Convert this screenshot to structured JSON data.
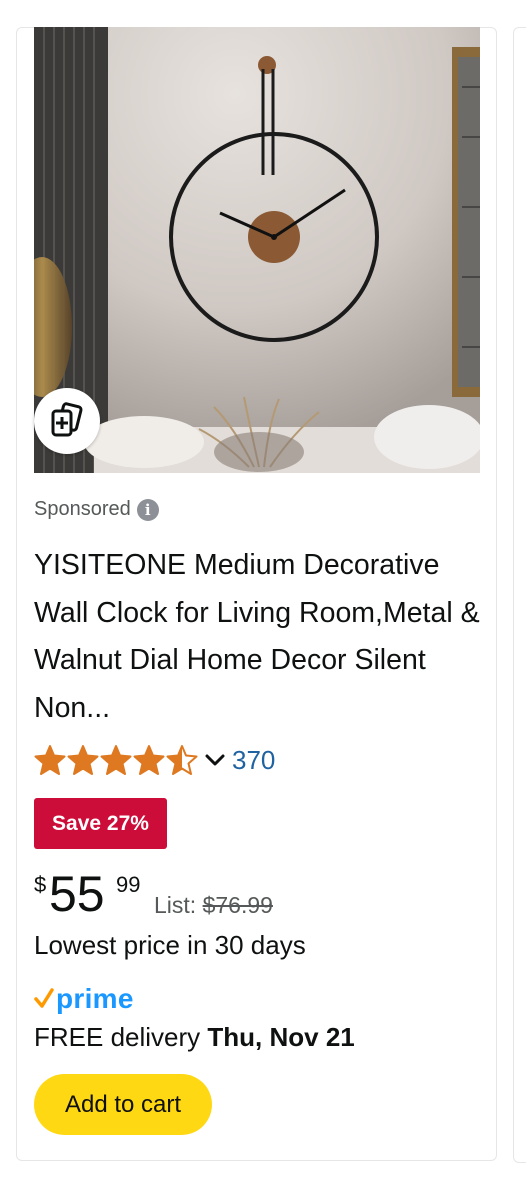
{
  "product": {
    "sponsored_label": "Sponsored",
    "info_glyph": "i",
    "title": "YISITEONE Medium Decorative Wall Clock for Living Room,Metal & Walnut Dial Home Decor Silent Non...",
    "rating": {
      "stars": 4.5,
      "max_stars": 5,
      "review_count": "370"
    },
    "save_badge": "Save 27%",
    "price": {
      "currency": "$",
      "whole": "55",
      "fraction": "99",
      "list_label": "List:",
      "list_value": "$76.99"
    },
    "lowest_price_note": "Lowest price in 30 days",
    "prime_label": "prime",
    "delivery": {
      "prefix": "FREE delivery",
      "date": "Thu, Nov 21"
    },
    "add_to_cart_label": "Add to cart",
    "image_alt": "wall clock photo"
  },
  "colors": {
    "star": "#de7921",
    "save_badge_bg": "#cc0c39",
    "prime_blue": "#1a98ff",
    "prime_check": "#ff9900",
    "add_to_cart_bg": "#ffd814",
    "link": "#2162a1"
  },
  "icons": {
    "compare": "compare-add-icon",
    "info": "info-icon",
    "chevron": "chevron-down-icon",
    "prime_check": "prime-check-icon"
  }
}
